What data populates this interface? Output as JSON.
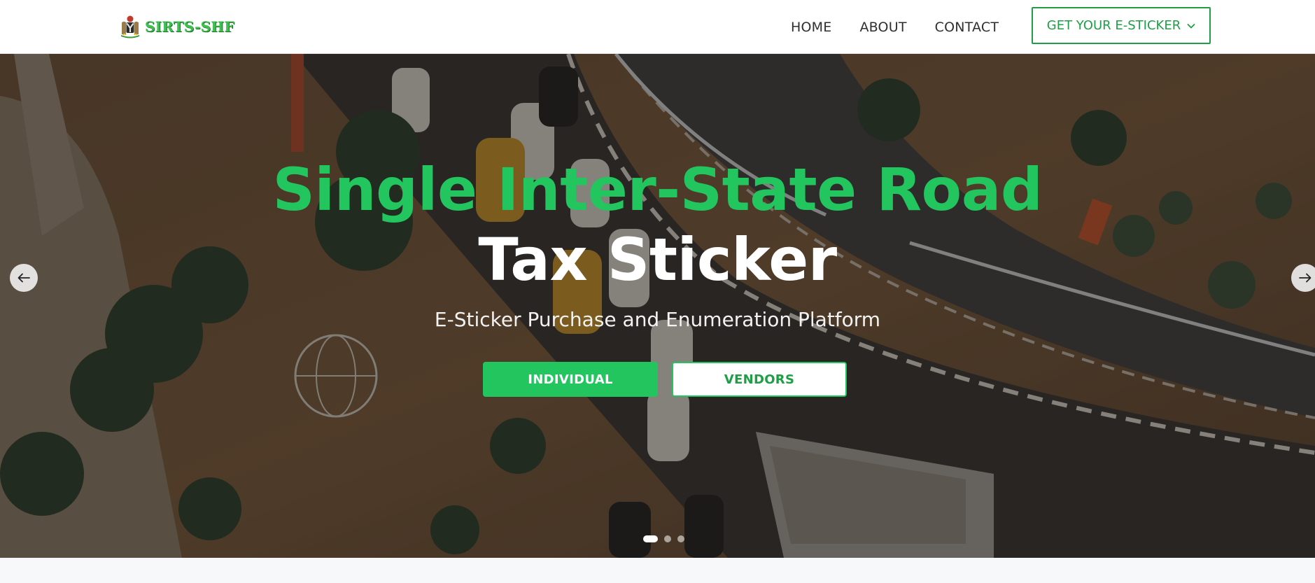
{
  "brand": {
    "name": "SIRTS-SHF",
    "emblem_icon": "coat-of-arms-icon",
    "color": "#3fbf4f"
  },
  "nav": {
    "items": [
      {
        "label": "HOME"
      },
      {
        "label": "ABOUT"
      },
      {
        "label": "CONTACT"
      }
    ],
    "cta": {
      "label": "GET YOUR E-STICKER",
      "icon": "chevron-down-icon"
    }
  },
  "hero": {
    "title_line_1": "Single Inter-State Road",
    "title_line_2": "Tax Sticker",
    "subtitle": "E-Sticker Purchase and Enumeration Platform",
    "buttons": {
      "individual": "INDIVIDUAL",
      "vendors": "VENDORS"
    },
    "carousel": {
      "prev_icon": "arrow-left-icon",
      "next_icon": "arrow-right-icon",
      "slide_count": 3,
      "active_slide": 1
    },
    "background": "aerial view of a road interchange with traffic, trees and fenced paths"
  },
  "colors": {
    "accent_green": "#22c55e",
    "dark_green": "#1f9e45",
    "white": "#ffffff"
  }
}
